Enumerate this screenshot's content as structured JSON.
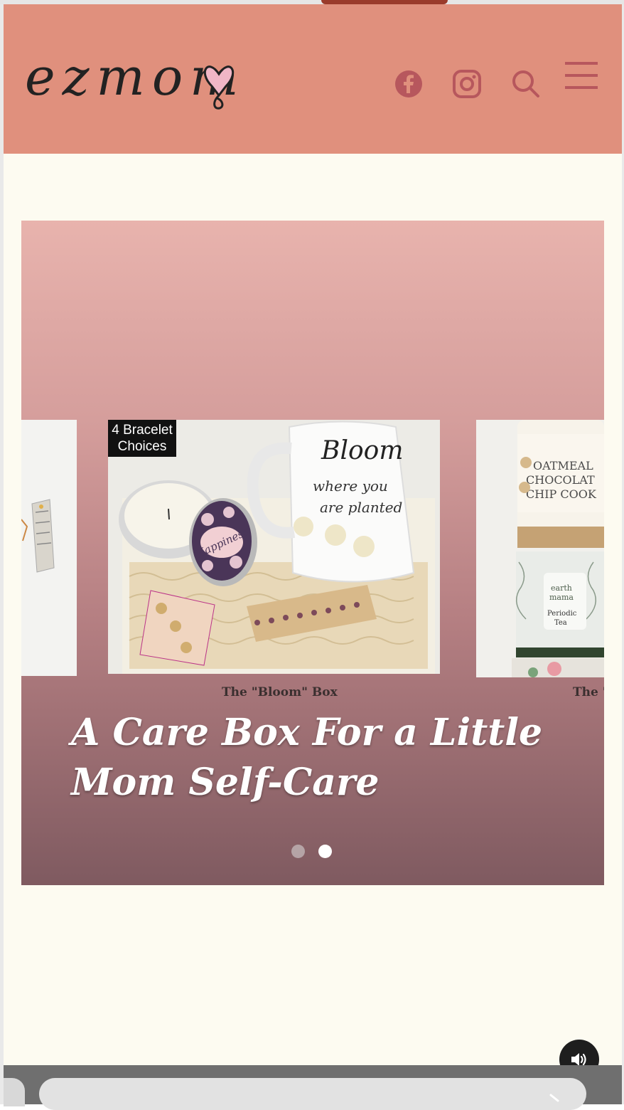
{
  "header": {
    "logo_text": "ezmom",
    "icons": [
      "facebook-icon",
      "instagram-icon",
      "search-icon",
      "menu-icon"
    ]
  },
  "hero": {
    "badge": "4 Bracelet\nChoices",
    "title": "A Care Box For a Little Mom Self-Care",
    "captions": [
      "The \"Bloom\" Box",
      "The \""
    ],
    "pagination": {
      "count": 2,
      "active": 2
    }
  },
  "colors": {
    "header_bg": "#e0907d",
    "page_bg": "#fdfbf1",
    "icon_color": "#b7575d"
  },
  "controls": {
    "sound_icon": "volume-icon"
  }
}
